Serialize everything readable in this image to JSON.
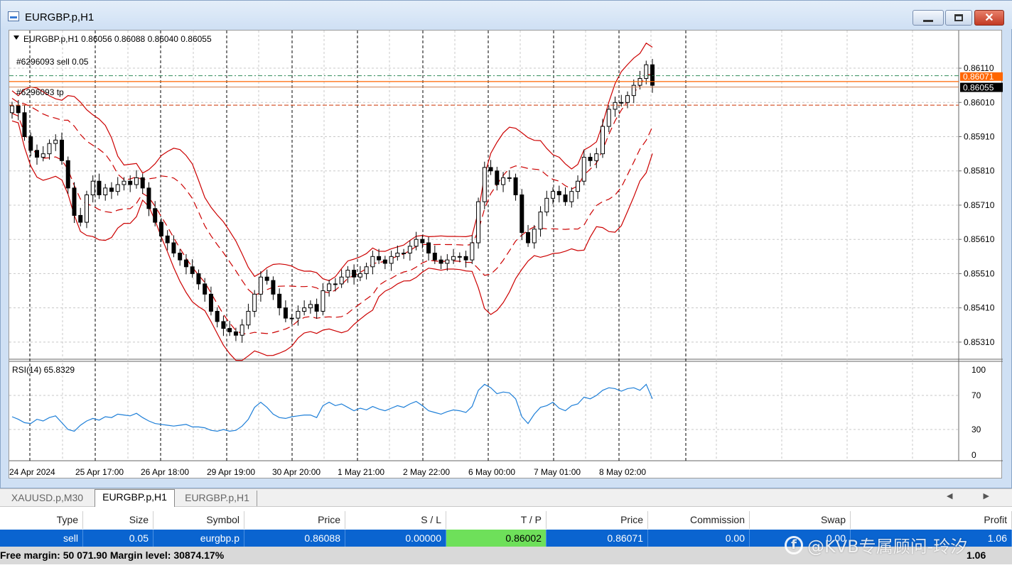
{
  "window": {
    "title": "EURGBP.p,H1",
    "close_glyph": "✕"
  },
  "chart_data": {
    "type": "candlestick",
    "symbol_header": "EURGBP.p,H1",
    "ohlc_header": "0.86056 0.86088 0.86040 0.86055",
    "y_ticks": [
      "0.86110",
      "0.86010",
      "0.85910",
      "0.85810",
      "0.85710",
      "0.85610",
      "0.85510",
      "0.85410",
      "0.85310"
    ],
    "ylim": [
      0.8526,
      0.8622
    ],
    "x_labels": [
      "24 Apr 2024",
      "25 Apr 17:00",
      "26 Apr 18:00",
      "29 Apr 19:00",
      "30 Apr 20:00",
      "1 May 21:00",
      "2 May 22:00",
      "6 May 00:00",
      "7 May 01:00",
      "8 May 02:00"
    ],
    "order_label": "#6296093 sell 0.05",
    "tp_label": "#6296093 tp",
    "open_price": 0.86088,
    "tp_price": 0.86002,
    "bid_price": "0.86071",
    "current_price": "0.86055",
    "bollinger": "red bands",
    "close_path": [
      0.86,
      0.8598,
      0.8591,
      0.8587,
      0.8585,
      0.8586,
      0.8589,
      0.859,
      0.8584,
      0.8576,
      0.8568,
      0.8566,
      0.8574,
      0.8578,
      0.8574,
      0.8576,
      0.8575,
      0.8577,
      0.8578,
      0.8577,
      0.8579,
      0.8576,
      0.857,
      0.8566,
      0.8562,
      0.856,
      0.8557,
      0.8555,
      0.8553,
      0.8551,
      0.8548,
      0.8545,
      0.854,
      0.8537,
      0.8535,
      0.8534,
      0.8533,
      0.8536,
      0.854,
      0.8545,
      0.855,
      0.8549,
      0.8545,
      0.8541,
      0.8538,
      0.8538,
      0.854,
      0.8541,
      0.8542,
      0.854,
      0.8546,
      0.8548,
      0.8548,
      0.855,
      0.8552,
      0.855,
      0.8551,
      0.8553,
      0.8556,
      0.8555,
      0.8554,
      0.8556,
      0.8557,
      0.8557,
      0.8559,
      0.8561,
      0.856,
      0.8557,
      0.8555,
      0.8554,
      0.8555,
      0.8556,
      0.8556,
      0.8555,
      0.856,
      0.8572,
      0.8582,
      0.8581,
      0.8577,
      0.8579,
      0.8579,
      0.8574,
      0.8563,
      0.856,
      0.8564,
      0.8569,
      0.8573,
      0.8575,
      0.8574,
      0.8572,
      0.8575,
      0.8578,
      0.8585,
      0.8584,
      0.8586,
      0.8594,
      0.8599,
      0.8601,
      0.8601,
      0.8603,
      0.8606,
      0.8608,
      0.8612,
      0.8606
    ]
  },
  "rsi": {
    "label": "RSI(14) 65.8329",
    "ticks": [
      "100",
      "70",
      "30",
      "0"
    ],
    "values": [
      45,
      42,
      38,
      37,
      42,
      40,
      44,
      46,
      38,
      30,
      28,
      35,
      40,
      43,
      41,
      45,
      44,
      48,
      47,
      46,
      49,
      44,
      40,
      37,
      36,
      35,
      34,
      35,
      36,
      33,
      33,
      32,
      29,
      28,
      30,
      28,
      29,
      34,
      42,
      56,
      62,
      56,
      48,
      44,
      43,
      45,
      46,
      47,
      47,
      44,
      58,
      62,
      58,
      60,
      56,
      52,
      55,
      53,
      57,
      54,
      52,
      55,
      58,
      56,
      60,
      63,
      58,
      52,
      50,
      48,
      51,
      53,
      52,
      50,
      57,
      76,
      83,
      79,
      72,
      74,
      73,
      66,
      45,
      37,
      48,
      56,
      58,
      62,
      55,
      52,
      58,
      60,
      68,
      66,
      70,
      76,
      79,
      78,
      75,
      78,
      79,
      76,
      83,
      66
    ]
  },
  "tabs": [
    {
      "label": "XAUUSD.p,M30"
    },
    {
      "label": "EURGBP.p,H1"
    },
    {
      "label": "EURGBP.p,H1"
    }
  ],
  "tab_scroll": "◀ ▶",
  "table": {
    "headers": [
      "Type",
      "Size",
      "Symbol",
      "Price",
      "S / L",
      "T / P",
      "Price",
      "Commission",
      "Swap",
      "Profit"
    ],
    "row": [
      "sell",
      "0.05",
      "eurgbp.p",
      "0.86088",
      "0.00000",
      "0.86002",
      "0.86071",
      "0.00",
      "0.00",
      "1.06"
    ]
  },
  "summary": {
    "text": "Free margin: 50 071.90  Margin level: 30874.17%",
    "profit": "1.06"
  },
  "watermark": {
    "logo": "f",
    "text": "@KVB专属顾问-玲汐"
  },
  "colors": {
    "candle": "#000000",
    "bands": "#cc0000",
    "rsi": "#1e7fd8",
    "current_price_box": "#000000",
    "bid_box": "#ff6600",
    "selected_row": "#0a64d0",
    "tp_highlight": "#6ee05a"
  }
}
